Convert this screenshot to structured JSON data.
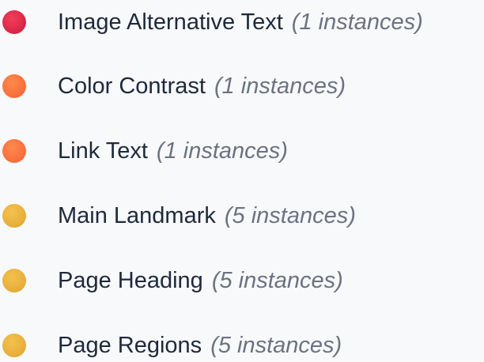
{
  "issues": [
    {
      "title": "Image Alternative Text",
      "count": "(1 instances)",
      "severity": "red",
      "color": "#e0304f"
    },
    {
      "title": "Color Contrast",
      "count": "(1 instances)",
      "severity": "orange",
      "color": "#f8743f"
    },
    {
      "title": "Link Text",
      "count": "(1 instances)",
      "severity": "orange",
      "color": "#f8743f"
    },
    {
      "title": "Main Landmark",
      "count": "(5 instances)",
      "severity": "yellow",
      "color": "#e8b23d"
    },
    {
      "title": "Page Heading",
      "count": "(5 instances)",
      "severity": "yellow",
      "color": "#e8b23d"
    },
    {
      "title": "Page Regions",
      "count": "(5 instances)",
      "severity": "yellow",
      "color": "#e8b23d"
    }
  ]
}
